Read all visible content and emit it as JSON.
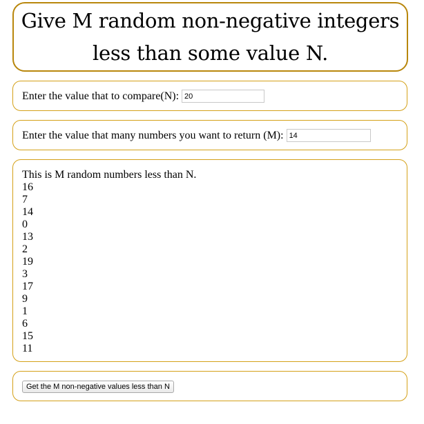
{
  "header": {
    "title_line1": "Give M random non-negative integers",
    "title_line2": "less than some value N."
  },
  "n_field": {
    "label": "Enter the value that to compare(N):",
    "value": "20"
  },
  "m_field": {
    "label": "Enter the value that many numbers you want to return (M):",
    "value": "14"
  },
  "results": {
    "heading": "This is M random numbers less than N.",
    "values": [
      "16",
      "7",
      "14",
      "0",
      "13",
      "2",
      "19",
      "3",
      "17",
      "9",
      "1",
      "6",
      "15",
      "11"
    ]
  },
  "actions": {
    "submit_label": "Get the M non-negative values less than N"
  },
  "colors": {
    "header_border": "#b8860b",
    "box_border": "#d4a017"
  }
}
